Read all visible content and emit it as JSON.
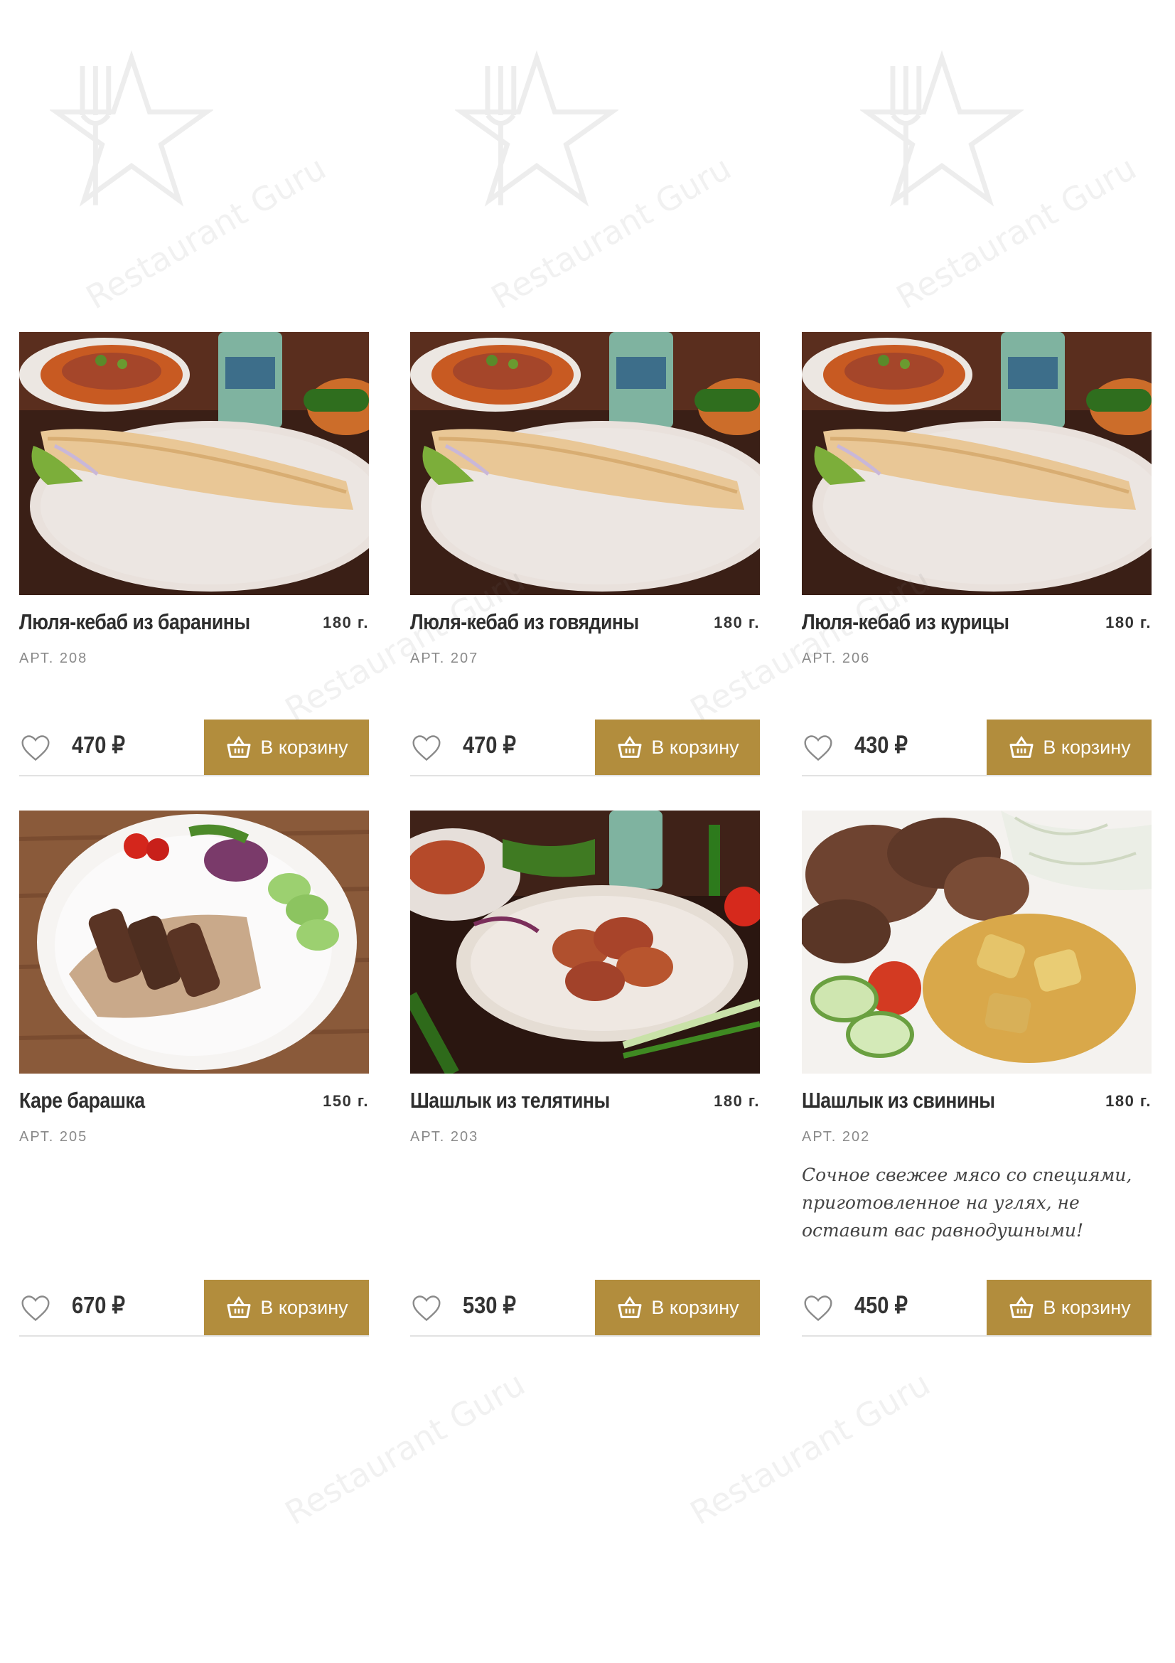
{
  "watermark": {
    "brand": "Restaurant Guru"
  },
  "currency": "₽",
  "cart_label": "В корзину",
  "colors": {
    "accent": "#b28d3d",
    "text": "#2e2e2e",
    "muted": "#8a8a8a",
    "divider": "#e2e2e2"
  },
  "products": [
    {
      "name": "Люля-кебаб из баранины",
      "weight": "180 г.",
      "art": "АРТ. 208",
      "price": "470",
      "image": "lula-kebab-wrap-photo"
    },
    {
      "name": "Люля-кебаб из говядины",
      "weight": "180 г.",
      "art": "АРТ. 207",
      "price": "470",
      "image": "lula-kebab-wrap-photo"
    },
    {
      "name": "Люля-кебаб из курицы",
      "weight": "180 г.",
      "art": "АРТ. 206",
      "price": "430",
      "image": "lula-kebab-wrap-photo"
    },
    {
      "name": "Каре барашка",
      "weight": "150 г.",
      "art": "АРТ. 205",
      "price": "670",
      "image": "lamb-rack-photo"
    },
    {
      "name": "Шашлык из телятины",
      "weight": "180 г.",
      "art": "АРТ. 203",
      "price": "530",
      "image": "veal-shashlik-photo"
    },
    {
      "name": "Шашлык из свинины",
      "weight": "180 г.",
      "art": "АРТ. 202",
      "price": "450",
      "image": "pork-shashlik-photo",
      "description": "Сочное свежее мясо со специями, приготовленное на углях, не оставит вас равнодушными!"
    }
  ]
}
